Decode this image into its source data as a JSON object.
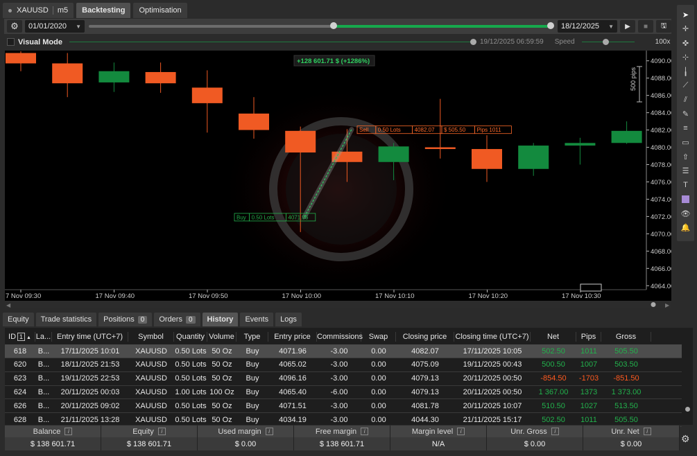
{
  "top_tabs": {
    "symbol": "XAUUSD",
    "timeframe": "m5",
    "backtesting": "Backtesting",
    "optimisation": "Optimisation"
  },
  "toolbar": {
    "start_date": "01/01/2020",
    "end_date": "18/12/2025",
    "progress_knob_fraction": 0.53
  },
  "visual_mode": {
    "label": "Visual Mode",
    "time": "19/12/2025 06:59:59",
    "speed_label": "Speed",
    "speed_value": "100x"
  },
  "chart_data": {
    "type": "candlestick",
    "pnl_label": "+128 601.71 $ (+1286%)",
    "scale_label": "500 pips",
    "ylim": [
      4063.3,
      4091.1
    ],
    "y_ticks": [
      "4090.00",
      "4088.00",
      "4086.00",
      "4084.00",
      "4082.00",
      "4080.00",
      "4078.00",
      "4076.00",
      "4074.00",
      "4072.00",
      "4070.00",
      "4068.00",
      "4066.00",
      "4064.00"
    ],
    "x_ticks": [
      "7 Nov 09:30",
      "17 Nov 09:40",
      "17 Nov 09:50",
      "17 Nov 10:00",
      "17 Nov 10:10",
      "17 Nov 10:20",
      "17 Nov 10:30"
    ],
    "candles": [
      {
        "open": 4090.9,
        "close": 4089.7,
        "high": 4091.1,
        "low": 4088.8
      },
      {
        "open": 4089.7,
        "close": 4087.4,
        "high": 4090.9,
        "low": 4085.8
      },
      {
        "open": 4087.5,
        "close": 4088.8,
        "high": 4089.8,
        "low": 4086.4
      },
      {
        "open": 4088.7,
        "close": 4087.4,
        "high": 4089.8,
        "low": 4086.3
      },
      {
        "open": 4086.9,
        "close": 4085.1,
        "high": 4088.9,
        "low": 4081.7
      },
      {
        "open": 4083.9,
        "close": 4082.0,
        "high": 4085.8,
        "low": 4081.0
      },
      {
        "open": 4081.9,
        "close": 4079.4,
        "high": 4082.4,
        "low": 4070.2
      },
      {
        "open": 4079.5,
        "close": 4078.3,
        "high": 4082.1,
        "low": 4076.0
      },
      {
        "open": 4078.3,
        "close": 4080.1,
        "high": 4080.5,
        "low": 4076.2
      },
      {
        "open": 4080.0,
        "close": 4079.8,
        "high": 4085.6,
        "low": 4078.7
      },
      {
        "open": 4079.8,
        "close": 4077.5,
        "high": 4081.4,
        "low": 4076.0
      },
      {
        "open": 4077.5,
        "close": 4080.2,
        "high": 4080.5,
        "low": 4076.7
      },
      {
        "open": 4080.2,
        "close": 4080.5,
        "high": 4081.1,
        "low": 4078.0
      },
      {
        "open": 4080.5,
        "close": 4081.9,
        "high": 4083.0,
        "low": 4080.4
      }
    ],
    "sell_label": [
      "Sell",
      "0.50 Lots",
      "4082.07",
      "$ 505.50",
      "Pips 1011"
    ],
    "buy_label": [
      "Buy",
      "0.50 Lots",
      "4071.96"
    ],
    "sell_price": 4082.07,
    "buy_price": 4071.96
  },
  "bottom_tabs": {
    "equity": "Equity",
    "trade_statistics": "Trade statistics",
    "positions": "Positions",
    "positions_count": "0",
    "orders": "Orders",
    "orders_count": "0",
    "history": "History",
    "events": "Events",
    "logs": "Logs"
  },
  "history": {
    "columns": [
      "ID",
      "La...",
      "Entry time (UTC+7)",
      "Symbol",
      "Quantity",
      "Volume",
      "Type",
      "Entry price",
      "Commissions",
      "Swap",
      "Closing price",
      "Closing time (UTC+7)",
      "Net",
      "Pips",
      "Gross"
    ],
    "sort_index": "1",
    "rows": [
      [
        "618",
        "B...",
        "17/11/2025 10:01",
        "XAUUSD",
        "0.50 Lots",
        "50 Oz",
        "Buy",
        "4071.96",
        "-3.00",
        "0.00",
        "4082.07",
        "17/11/2025 10:05",
        "502.50",
        "1011",
        "505.50"
      ],
      [
        "620",
        "B...",
        "18/11/2025 21:53",
        "XAUUSD",
        "0.50 Lots",
        "50 Oz",
        "Buy",
        "4065.02",
        "-3.00",
        "0.00",
        "4075.09",
        "19/11/2025 00:43",
        "500.50",
        "1007",
        "503.50"
      ],
      [
        "623",
        "B...",
        "19/11/2025 22:53",
        "XAUUSD",
        "0.50 Lots",
        "50 Oz",
        "Buy",
        "4096.16",
        "-3.00",
        "0.00",
        "4079.13",
        "20/11/2025 00:50",
        "-854.50",
        "-1703",
        "-851.50"
      ],
      [
        "624",
        "B...",
        "20/11/2025 00:03",
        "XAUUSD",
        "1.00 Lots",
        "100 Oz",
        "Buy",
        "4065.40",
        "-6.00",
        "0.00",
        "4079.13",
        "20/11/2025 00:50",
        "1 367.00",
        "1373",
        "1 373.00"
      ],
      [
        "626",
        "B...",
        "20/11/2025 09:02",
        "XAUUSD",
        "0.50 Lots",
        "50 Oz",
        "Buy",
        "4071.51",
        "-3.00",
        "0.00",
        "4081.78",
        "20/11/2025 10:07",
        "510.50",
        "1027",
        "513.50"
      ],
      [
        "628",
        "B...",
        "21/11/2025 13:28",
        "XAUUSD",
        "0.50 Lots",
        "50 Oz",
        "Buy",
        "4034.19",
        "-3.00",
        "0.00",
        "4044.30",
        "21/11/2025 15:17",
        "502.50",
        "1011",
        "505.50"
      ]
    ]
  },
  "summary": [
    {
      "label": "Balance",
      "value": "$ 138 601.71"
    },
    {
      "label": "Equity",
      "value": "$ 138 601.71"
    },
    {
      "label": "Used margin",
      "value": "$ 0.00"
    },
    {
      "label": "Free margin",
      "value": "$ 138 601.71"
    },
    {
      "label": "Margin level",
      "value": "N/A"
    },
    {
      "label": "Unr. Gross",
      "value": "$ 0.00"
    },
    {
      "label": "Unr. Net",
      "value": "$ 0.00"
    }
  ],
  "colors": {
    "bull": "#138a3e",
    "bear": "#f05a23",
    "positive": "#22b14c",
    "negative": "#ff5a1f"
  }
}
